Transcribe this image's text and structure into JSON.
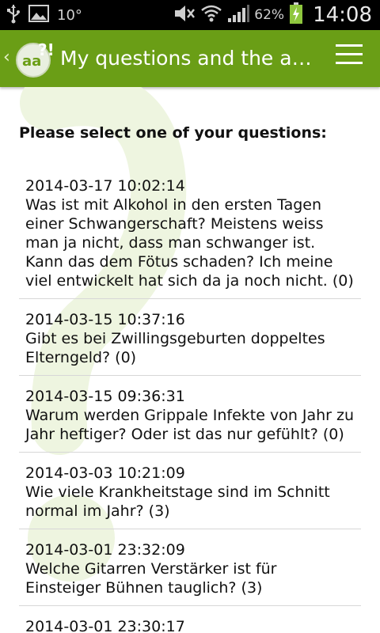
{
  "status_bar": {
    "temperature": "10°",
    "battery_percent": "62%",
    "time": "14:08"
  },
  "app_bar": {
    "title": "My questions and the a…",
    "logo_text": "aa?!"
  },
  "prompt": "Please select one of your questions:",
  "questions": [
    {
      "date": "2014-03-17 10:02:14",
      "text": "Was ist mit Alkohol in den ersten Tagen einer Schwangerschaft? Meistens weiss man ja nicht, dass man schwanger ist. Kann das dem Fötus schaden? Ich meine viel entwickelt hat sich da ja noch nicht. (0)"
    },
    {
      "date": "2014-03-15 10:37:16",
      "text": "Gibt es bei Zwillingsgeburten doppeltes Elterngeld? (0)"
    },
    {
      "date": "2014-03-15 09:36:31",
      "text": "Warum werden Grippale Infekte von Jahr zu Jahr heftiger? Oder ist das nur gefühlt? (0)"
    },
    {
      "date": "2014-03-03 10:21:09",
      "text": "Wie viele Krankheitstage sind im Schnitt normal im Jahr? (3)"
    },
    {
      "date": "2014-03-01 23:32:09",
      "text": "Welche Gitarren Verstärker ist für Einsteiger Bühnen tauglich? (3)"
    },
    {
      "date": "2014-03-01 23:30:17",
      "text": ""
    }
  ],
  "colors": {
    "app_bar": "#6a9e16",
    "status_bar": "#000000",
    "watermark": "#eef5e0"
  },
  "icons": {
    "status_left": [
      "usb-icon",
      "image-icon"
    ],
    "status_right": [
      "mute-icon",
      "wifi-icon",
      "signal-icon",
      "battery-charging-icon"
    ],
    "app_bar": [
      "app-logo-icon",
      "menu-icon"
    ]
  }
}
